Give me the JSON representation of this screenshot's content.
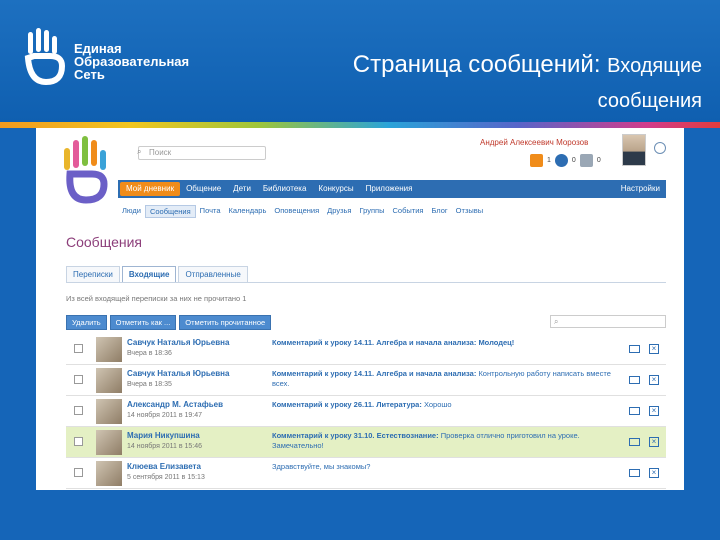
{
  "slide": {
    "org_name": "Единая\nОбразовательная\nСеть",
    "title_main": "Страница сообщений:",
    "title_sub_1": "Входящие",
    "title_sub_2": "сообщения"
  },
  "site": {
    "search_placeholder": "Поиск",
    "user_name": "Андрей Алексеевич Морозов",
    "icon_counts": [
      "1",
      "0",
      "0"
    ],
    "nav": [
      "Мой дневник",
      "Общение",
      "Дети",
      "Библиотека",
      "Конкурсы",
      "Приложения"
    ],
    "nav_right": "Настройки",
    "subnav": [
      "Люди",
      "Сообщения",
      "Почта",
      "Календарь",
      "Оповещения",
      "Друзья",
      "Группы",
      "События",
      "Блог",
      "Отзывы"
    ],
    "page_title": "Сообщения",
    "tabs": [
      "Переписки",
      "Входящие",
      "Отправленные"
    ],
    "hint": "Из всей входящей переписки за них не прочитано 1",
    "toolbar": [
      "Удалить",
      "Отметить как ...",
      "Отметить прочитанное"
    ],
    "filter_placeholder": ""
  },
  "messages": [
    {
      "sender": "Савчук Наталья Юрьевна",
      "date": "Вчера в 18:36",
      "topic": "Комментарий к уроку 14.11. Алгебра и начала анализа:",
      "body": "Молодец!",
      "highlight": false
    },
    {
      "sender": "Савчук Наталья Юрьевна",
      "date": "Вчера в 18:35",
      "topic": "Комментарий к уроку 14.11. Алгебра и начала анализа:",
      "body": "Контрольную работу написать вместе всех.",
      "highlight": false
    },
    {
      "sender": "Александр М. Астафьев",
      "date": "14 ноября 2011 в 19:47",
      "topic": "Комментарий к уроку 26.11. Литература:",
      "body": "Хорошо",
      "highlight": false
    },
    {
      "sender": "Мария Никупшина",
      "date": "14 ноября 2011 в 15:46",
      "topic": "Комментарий к уроку 31.10. Естествознание:",
      "body": "Проверка отлично приготовил на уроке. Замечательно!",
      "highlight": true
    },
    {
      "sender": "Клюева Елизавета",
      "date": "5 сентября 2011 в 15:13",
      "topic": "",
      "body": "Здравствуйте, мы знакомы?",
      "highlight": false
    }
  ],
  "colors": {
    "slide_blue": "#1565b8",
    "nav_blue": "#2d6db2",
    "nav_active": "#f08c1a",
    "title_purple": "#8c3e7a",
    "row_highlight": "#e4f0c4"
  }
}
